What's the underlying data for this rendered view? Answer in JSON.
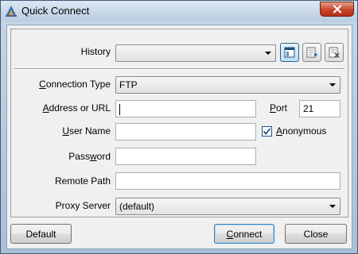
{
  "window": {
    "title": "Quick Connect",
    "close_label": "X"
  },
  "history": {
    "label": "History",
    "value": "",
    "buttons": [
      {
        "name": "history-open-button",
        "icon": "window-icon"
      },
      {
        "name": "history-add-button",
        "icon": "add-to-list-icon"
      },
      {
        "name": "history-remove-button",
        "icon": "remove-from-list-icon"
      }
    ]
  },
  "form": {
    "connection_type": {
      "label_pre": "",
      "label_ul": "C",
      "label_post": "onnection Type",
      "value": "FTP"
    },
    "address": {
      "label_pre": "",
      "label_ul": "A",
      "label_post": "ddress or URL",
      "value": ""
    },
    "port": {
      "label_pre": "",
      "label_ul": "P",
      "label_post": "ort",
      "value": "21"
    },
    "username": {
      "label_pre": "",
      "label_ul": "U",
      "label_post": "ser Name",
      "value": ""
    },
    "anonymous": {
      "label_pre": "",
      "label_ul": "A",
      "label_post": "nonymous",
      "checked": true
    },
    "password": {
      "label_pre": "Pass",
      "label_ul": "w",
      "label_post": "ord",
      "value": ""
    },
    "remote_path": {
      "label": "Remote Path",
      "value": ""
    },
    "proxy": {
      "label": "Proxy Server",
      "value": "(default)"
    }
  },
  "buttons": {
    "default_label": "Default",
    "connect_pre": "",
    "connect_ul": "C",
    "connect_post": "onnect",
    "close_label": "Close"
  },
  "colors": {
    "titlebar": "#c6d6e6",
    "close": "#c6452c",
    "focus": "#3c7fb1"
  }
}
